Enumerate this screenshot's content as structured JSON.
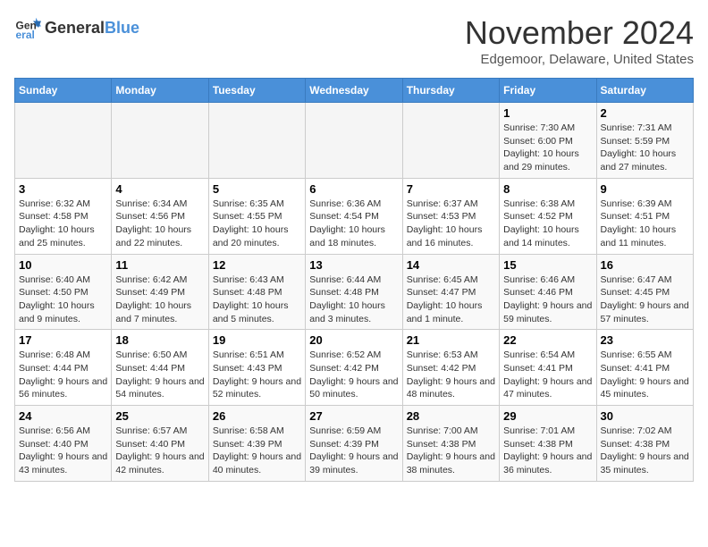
{
  "header": {
    "logo_general": "General",
    "logo_blue": "Blue",
    "month": "November 2024",
    "location": "Edgemoor, Delaware, United States"
  },
  "days_of_week": [
    "Sunday",
    "Monday",
    "Tuesday",
    "Wednesday",
    "Thursday",
    "Friday",
    "Saturday"
  ],
  "weeks": [
    [
      {
        "day": "",
        "info": ""
      },
      {
        "day": "",
        "info": ""
      },
      {
        "day": "",
        "info": ""
      },
      {
        "day": "",
        "info": ""
      },
      {
        "day": "",
        "info": ""
      },
      {
        "day": "1",
        "info": "Sunrise: 7:30 AM\nSunset: 6:00 PM\nDaylight: 10 hours and 29 minutes."
      },
      {
        "day": "2",
        "info": "Sunrise: 7:31 AM\nSunset: 5:59 PM\nDaylight: 10 hours and 27 minutes."
      }
    ],
    [
      {
        "day": "3",
        "info": "Sunrise: 6:32 AM\nSunset: 4:58 PM\nDaylight: 10 hours and 25 minutes."
      },
      {
        "day": "4",
        "info": "Sunrise: 6:34 AM\nSunset: 4:56 PM\nDaylight: 10 hours and 22 minutes."
      },
      {
        "day": "5",
        "info": "Sunrise: 6:35 AM\nSunset: 4:55 PM\nDaylight: 10 hours and 20 minutes."
      },
      {
        "day": "6",
        "info": "Sunrise: 6:36 AM\nSunset: 4:54 PM\nDaylight: 10 hours and 18 minutes."
      },
      {
        "day": "7",
        "info": "Sunrise: 6:37 AM\nSunset: 4:53 PM\nDaylight: 10 hours and 16 minutes."
      },
      {
        "day": "8",
        "info": "Sunrise: 6:38 AM\nSunset: 4:52 PM\nDaylight: 10 hours and 14 minutes."
      },
      {
        "day": "9",
        "info": "Sunrise: 6:39 AM\nSunset: 4:51 PM\nDaylight: 10 hours and 11 minutes."
      }
    ],
    [
      {
        "day": "10",
        "info": "Sunrise: 6:40 AM\nSunset: 4:50 PM\nDaylight: 10 hours and 9 minutes."
      },
      {
        "day": "11",
        "info": "Sunrise: 6:42 AM\nSunset: 4:49 PM\nDaylight: 10 hours and 7 minutes."
      },
      {
        "day": "12",
        "info": "Sunrise: 6:43 AM\nSunset: 4:48 PM\nDaylight: 10 hours and 5 minutes."
      },
      {
        "day": "13",
        "info": "Sunrise: 6:44 AM\nSunset: 4:48 PM\nDaylight: 10 hours and 3 minutes."
      },
      {
        "day": "14",
        "info": "Sunrise: 6:45 AM\nSunset: 4:47 PM\nDaylight: 10 hours and 1 minute."
      },
      {
        "day": "15",
        "info": "Sunrise: 6:46 AM\nSunset: 4:46 PM\nDaylight: 9 hours and 59 minutes."
      },
      {
        "day": "16",
        "info": "Sunrise: 6:47 AM\nSunset: 4:45 PM\nDaylight: 9 hours and 57 minutes."
      }
    ],
    [
      {
        "day": "17",
        "info": "Sunrise: 6:48 AM\nSunset: 4:44 PM\nDaylight: 9 hours and 56 minutes."
      },
      {
        "day": "18",
        "info": "Sunrise: 6:50 AM\nSunset: 4:44 PM\nDaylight: 9 hours and 54 minutes."
      },
      {
        "day": "19",
        "info": "Sunrise: 6:51 AM\nSunset: 4:43 PM\nDaylight: 9 hours and 52 minutes."
      },
      {
        "day": "20",
        "info": "Sunrise: 6:52 AM\nSunset: 4:42 PM\nDaylight: 9 hours and 50 minutes."
      },
      {
        "day": "21",
        "info": "Sunrise: 6:53 AM\nSunset: 4:42 PM\nDaylight: 9 hours and 48 minutes."
      },
      {
        "day": "22",
        "info": "Sunrise: 6:54 AM\nSunset: 4:41 PM\nDaylight: 9 hours and 47 minutes."
      },
      {
        "day": "23",
        "info": "Sunrise: 6:55 AM\nSunset: 4:41 PM\nDaylight: 9 hours and 45 minutes."
      }
    ],
    [
      {
        "day": "24",
        "info": "Sunrise: 6:56 AM\nSunset: 4:40 PM\nDaylight: 9 hours and 43 minutes."
      },
      {
        "day": "25",
        "info": "Sunrise: 6:57 AM\nSunset: 4:40 PM\nDaylight: 9 hours and 42 minutes."
      },
      {
        "day": "26",
        "info": "Sunrise: 6:58 AM\nSunset: 4:39 PM\nDaylight: 9 hours and 40 minutes."
      },
      {
        "day": "27",
        "info": "Sunrise: 6:59 AM\nSunset: 4:39 PM\nDaylight: 9 hours and 39 minutes."
      },
      {
        "day": "28",
        "info": "Sunrise: 7:00 AM\nSunset: 4:38 PM\nDaylight: 9 hours and 38 minutes."
      },
      {
        "day": "29",
        "info": "Sunrise: 7:01 AM\nSunset: 4:38 PM\nDaylight: 9 hours and 36 minutes."
      },
      {
        "day": "30",
        "info": "Sunrise: 7:02 AM\nSunset: 4:38 PM\nDaylight: 9 hours and 35 minutes."
      }
    ]
  ]
}
